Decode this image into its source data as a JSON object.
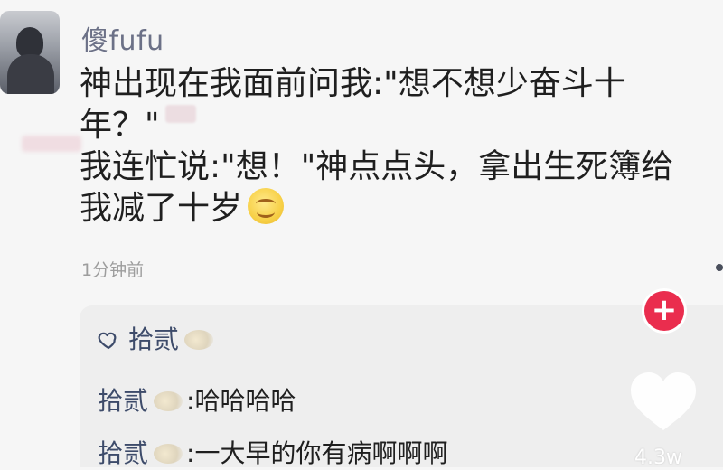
{
  "post": {
    "username": "傻fufu",
    "content_lines": [
      "神出现在我面前问我:\"想不想少奋斗十",
      "年？\"",
      "我连忙说:\"想！\"神点点头，拿出生死簿给",
      "我减了十岁"
    ],
    "emoji_icon": "smiling-face-icon",
    "timestamp": "1分钟前"
  },
  "actions": {
    "plus_label": "+",
    "like_count": "4.3w"
  },
  "replies": {
    "liker_name": "拾贰",
    "items": [
      {
        "name": "拾贰",
        "sep": ":",
        "text": "哈哈哈哈"
      },
      {
        "name": "拾贰",
        "sep": ":",
        "text": "一大早的你有病啊啊啊"
      }
    ]
  },
  "colors": {
    "username": "#6c7187",
    "reply_name": "#3d4b6a",
    "plus_button": "#ea2d4e",
    "reply_background": "#eeeeee",
    "page_background": "#f6f6f6"
  }
}
